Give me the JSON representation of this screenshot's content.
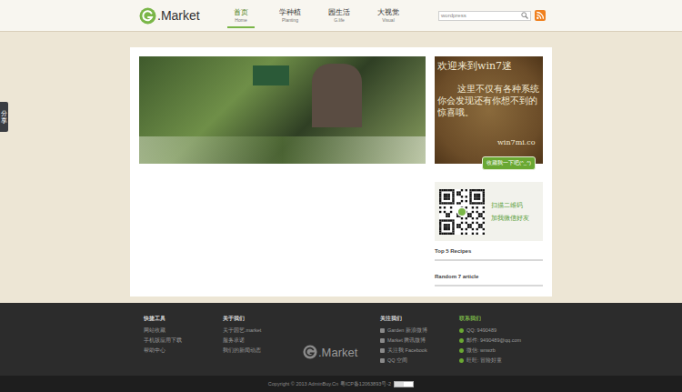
{
  "logo": {
    "text": ".Market"
  },
  "nav": [
    {
      "label": "首页",
      "sub": "Home",
      "selected": true
    },
    {
      "label": "学种植",
      "sub": "Planting",
      "selected": false
    },
    {
      "label": "园生活",
      "sub": "G.life",
      "selected": false
    },
    {
      "label": "大视觉",
      "sub": "Visual",
      "selected": false
    }
  ],
  "search": {
    "placeholder": "wordpress"
  },
  "share": "分享",
  "banner": {
    "title": "欢迎来到win7迷",
    "lines": [
      "这里不仅有各种系统",
      "你会发现还有你想不到的",
      "惊喜哦。"
    ],
    "site": "win7mi.co",
    "button": "收藏我一下吧(^_^)"
  },
  "qr": {
    "lines": [
      "扫描二维码",
      "加我微信好友"
    ]
  },
  "widgets": [
    "Top 5 Recipes",
    "Random 7 article"
  ],
  "footer": {
    "columns": [
      {
        "title": "快捷工具",
        "highlight": false,
        "links": [
          "网站收藏",
          "手机版应用下载",
          "帮助中心"
        ]
      },
      {
        "title": "关于我们",
        "highlight": false,
        "links": [
          "关于园艺.market",
          "服务承诺",
          "我们的新闻动态"
        ]
      }
    ],
    "logo": ".Market",
    "follow": {
      "title": "关注我们",
      "highlight": false,
      "links": [
        "Garden 新浪微博",
        "Market 腾讯微博",
        "关注我 Facebook",
        "QQ 空间"
      ]
    },
    "contact": {
      "title": "联系我们",
      "highlight": true,
      "links": [
        "QQ: 9490489",
        "邮件: 9490489@qq.com",
        "微信: wnwzb",
        "旺旺: 冒险好童"
      ]
    }
  },
  "copyright": "Copyright © 2013 AdminBuy.Cn 粤ICP备12063893号-2"
}
